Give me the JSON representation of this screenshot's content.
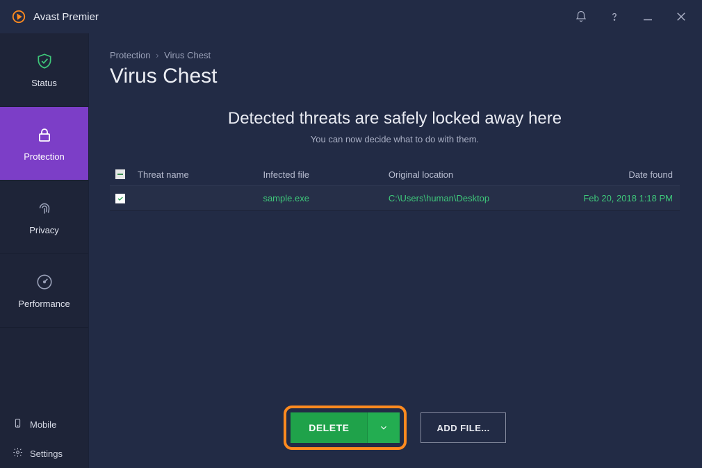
{
  "app": {
    "title": "Avast Premier"
  },
  "sidebar": {
    "items": [
      {
        "label": "Status"
      },
      {
        "label": "Protection"
      },
      {
        "label": "Privacy"
      },
      {
        "label": "Performance"
      }
    ],
    "bottom": [
      {
        "label": "Mobile"
      },
      {
        "label": "Settings"
      }
    ]
  },
  "breadcrumb": {
    "root": "Protection",
    "leaf": "Virus Chest"
  },
  "page": {
    "title": "Virus Chest",
    "subhead_title": "Detected threats are safely locked away here",
    "subhead_desc": "You can now decide what to do with them."
  },
  "table": {
    "headers": {
      "threat": "Threat name",
      "file": "Infected file",
      "location": "Original location",
      "date": "Date found"
    },
    "rows": [
      {
        "threat": "",
        "file": "sample.exe",
        "location": "C:\\Users\\human\\Desktop",
        "date": "Feb 20, 2018 1:18 PM"
      }
    ]
  },
  "footer": {
    "delete": "Delete",
    "add": "Add file..."
  }
}
